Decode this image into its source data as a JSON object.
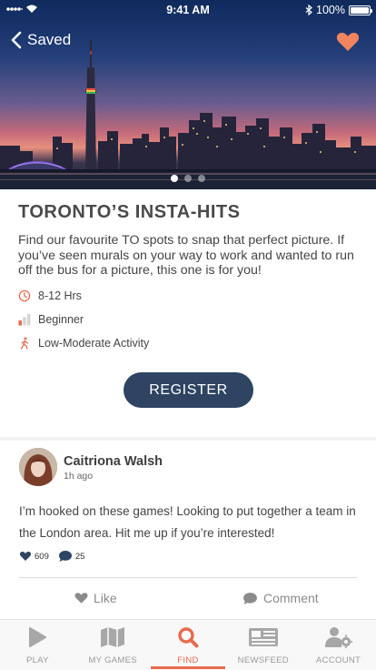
{
  "status_bar": {
    "time": "9:41 AM",
    "battery": "100%"
  },
  "nav": {
    "back_label": "Saved"
  },
  "colors": {
    "accent": "#e86b4e",
    "primary_button": "#2e4462",
    "heart": "#f0845f"
  },
  "carousel": {
    "count": 3,
    "active_index": 0
  },
  "event": {
    "title": "TORONTO’S INSTA-HITS",
    "description": "Find our favourite TO spots to snap that perfect picture. If you’ve seen murals on your way to work and wanted to run off the bus for a picture, this one is for you!",
    "duration": "8-12 Hrs",
    "level": "Beginner",
    "activity": "Low-Moderate Activity",
    "register_label": "REGISTER"
  },
  "post": {
    "author": "Caitriona Walsh",
    "time_ago": "1h ago",
    "text": "I’m hooked on these games! Looking to put together a team in the London area. Hit me up if you’re interested!",
    "likes": "609",
    "comments": "25",
    "like_label": "Like",
    "comment_label": "Comment"
  },
  "tabs": [
    {
      "label": "PLAY",
      "icon": "play-icon"
    },
    {
      "label": "MY GAMES",
      "icon": "map-icon"
    },
    {
      "label": "FIND",
      "icon": "search-icon",
      "active": true
    },
    {
      "label": "NEWSFEED",
      "icon": "newspaper-icon"
    },
    {
      "label": "ACCOUNT",
      "icon": "account-settings-icon"
    }
  ]
}
